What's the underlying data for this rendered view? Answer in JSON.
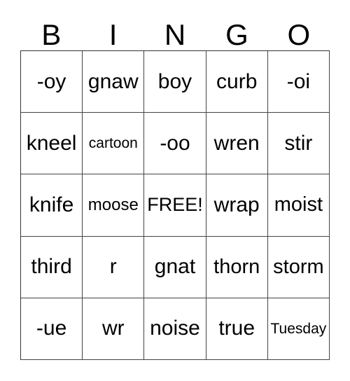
{
  "card": {
    "type": "bingo-card",
    "background_color": "#ffffff",
    "text_color": "#000000",
    "grid_line_color": "#444444",
    "header_letters": [
      "B",
      "I",
      "N",
      "G",
      "O"
    ],
    "columns": 5,
    "rows": 5,
    "free_space": {
      "row": 3,
      "column": 3,
      "label": "FREE!"
    },
    "grid": [
      [
        {
          "text": "-oy",
          "size": "fs-30"
        },
        {
          "text": "gnaw",
          "size": "fs-30"
        },
        {
          "text": "boy",
          "size": "fs-30"
        },
        {
          "text": "curb",
          "size": "fs-30"
        },
        {
          "text": "-oi",
          "size": "fs-30"
        }
      ],
      [
        {
          "text": "kneel",
          "size": "fs-30"
        },
        {
          "text": "cartoon",
          "size": "fs-21"
        },
        {
          "text": "-oo",
          "size": "fs-30"
        },
        {
          "text": "wren",
          "size": "fs-30"
        },
        {
          "text": "stir",
          "size": "fs-30"
        }
      ],
      [
        {
          "text": "knife",
          "size": "fs-30"
        },
        {
          "text": "moose",
          "size": "fs-24"
        },
        {
          "text": "FREE!",
          "size": "fs-27"
        },
        {
          "text": "wrap",
          "size": "fs-30"
        },
        {
          "text": "moist",
          "size": "fs-29"
        }
      ],
      [
        {
          "text": "third",
          "size": "fs-30"
        },
        {
          "text": "r",
          "size": "fs-30"
        },
        {
          "text": "gnat",
          "size": "fs-30"
        },
        {
          "text": "thorn",
          "size": "fs-29"
        },
        {
          "text": "storm",
          "size": "fs-29"
        }
      ],
      [
        {
          "text": "-ue",
          "size": "fs-30"
        },
        {
          "text": "wr",
          "size": "fs-30"
        },
        {
          "text": "noise",
          "size": "fs-30"
        },
        {
          "text": "true",
          "size": "fs-30"
        },
        {
          "text": "Tuesday",
          "size": "fs-21"
        }
      ]
    ]
  }
}
